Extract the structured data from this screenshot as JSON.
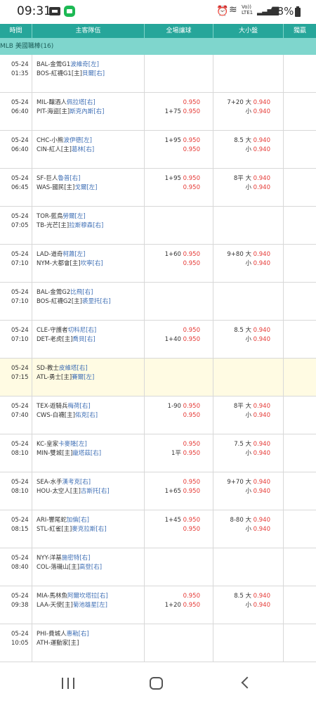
{
  "status_bar": {
    "time": "09:31",
    "icons": [
      "message-icon",
      "app-icon",
      "alarm-icon",
      "wifi-icon",
      "volte-icon",
      "signal-icon",
      "battery-icon"
    ],
    "volte_text": "Vo))\nLTE1",
    "battery": "88%"
  },
  "header": {
    "time": "時間",
    "teams": "主客隊伍",
    "handicap": "全場讓球",
    "over_under": "大小盤",
    "win": "獨贏"
  },
  "league": "MLB 美國職棒(16)",
  "colors": {
    "header_bg": "#26a69a",
    "league_bg": "#7fd6cd",
    "odds": "#e53935",
    "pitcher": "#3f6fb5",
    "highlight_row": "#fffbe3"
  },
  "matches": [
    {
      "date": "05-24",
      "time": "01:35",
      "away": "BAL-金鶯G1",
      "away_p": "波維奇[左]",
      "home": "BOS-紅襪G1[主]",
      "home_p": "貝爾[右]",
      "hdp1": "",
      "hdp1_odds": "",
      "hdp2": "",
      "hdp2_odds": "",
      "ou1": "",
      "ou1_odds": "",
      "ou2": "",
      "ou2_odds": ""
    },
    {
      "date": "05-24",
      "time": "06:40",
      "away": "MIL-釀酒人",
      "away_p": "佩拉塔[右]",
      "home": "PIT-海盜[主]",
      "home_p": "斯克內斯[右]",
      "hdp1": "",
      "hdp1_odds": "0.950",
      "hdp2": "1+75",
      "hdp2_odds": "0.950",
      "ou1": "7+20 大",
      "ou1_odds": "0.940",
      "ou2": "小",
      "ou2_odds": "0.940"
    },
    {
      "date": "05-24",
      "time": "06:40",
      "away": "CHC-小熊",
      "away_p": "波伊德[左]",
      "home": "CIN-紅人[主]",
      "home_p": "葛林[右]",
      "hdp1": "1+95",
      "hdp1_odds": "0.950",
      "hdp2": "",
      "hdp2_odds": "0.950",
      "ou1": "8.5 大",
      "ou1_odds": "0.940",
      "ou2": "小",
      "ou2_odds": "0.940"
    },
    {
      "date": "05-24",
      "time": "06:45",
      "away": "SF-巨人",
      "away_p": "魯普[右]",
      "home": "WAS-國民[主]",
      "home_p": "戈爾[左]",
      "hdp1": "1+95",
      "hdp1_odds": "0.950",
      "hdp2": "",
      "hdp2_odds": "0.950",
      "ou1": "8平 大",
      "ou1_odds": "0.940",
      "ou2": "小",
      "ou2_odds": "0.940"
    },
    {
      "date": "05-24",
      "time": "07:05",
      "away": "TOR-藍鳥",
      "away_p": "勞爾[左]",
      "home": "TB-光芒[主]",
      "home_p": "拉斯穆森[右]",
      "hdp1": "",
      "hdp1_odds": "",
      "hdp2": "",
      "hdp2_odds": "",
      "ou1": "",
      "ou1_odds": "",
      "ou2": "",
      "ou2_odds": ""
    },
    {
      "date": "05-24",
      "time": "07:10",
      "away": "LAD-道奇",
      "away_p": "柯蕭[左]",
      "home": "NYM-大都會[主]",
      "home_p": "坎寧[右]",
      "hdp1": "1+60",
      "hdp1_odds": "0.950",
      "hdp2": "",
      "hdp2_odds": "0.950",
      "ou1": "9+80 大",
      "ou1_odds": "0.940",
      "ou2": "小",
      "ou2_odds": "0.940"
    },
    {
      "date": "05-24",
      "time": "07:10",
      "away": "BAL-金鶯G2",
      "away_p": "比飛[右]",
      "home": "BOS-紅襪G2[主]",
      "home_p": "裘里托[右]",
      "hdp1": "",
      "hdp1_odds": "",
      "hdp2": "",
      "hdp2_odds": "",
      "ou1": "",
      "ou1_odds": "",
      "ou2": "",
      "ou2_odds": ""
    },
    {
      "date": "05-24",
      "time": "07:10",
      "away": "CLE-守護者",
      "away_p": "切科尼[右]",
      "home": "DET-老虎[主]",
      "home_p": "喬貝[右]",
      "hdp1": "",
      "hdp1_odds": "0.950",
      "hdp2": "1+40",
      "hdp2_odds": "0.950",
      "ou1": "8.5 大",
      "ou1_odds": "0.940",
      "ou2": "小",
      "ou2_odds": "0.940"
    },
    {
      "date": "05-24",
      "time": "07:15",
      "away": "SD-教士",
      "away_p": "皮維塔[右]",
      "home": "ATL-勇士[主]",
      "home_p": "賽爾[左]",
      "hdp1": "",
      "hdp1_odds": "",
      "hdp2": "",
      "hdp2_odds": "",
      "ou1": "",
      "ou1_odds": "",
      "ou2": "",
      "ou2_odds": "",
      "highlight": true
    },
    {
      "date": "05-24",
      "time": "07:40",
      "away": "TEX-遊騎兵",
      "away_p": "梅荷[右]",
      "home": "CWS-白襪[主]",
      "home_p": "佑克[右]",
      "hdp1": "1-90",
      "hdp1_odds": "0.950",
      "hdp2": "",
      "hdp2_odds": "0.950",
      "ou1": "8平 大",
      "ou1_odds": "0.940",
      "ou2": "小",
      "ou2_odds": "0.940"
    },
    {
      "date": "05-24",
      "time": "08:10",
      "away": "KC-皇家",
      "away_p": "卡麥隆[左]",
      "home": "MIN-雙城[主]",
      "home_p": "龐塔茲[右]",
      "hdp1": "",
      "hdp1_odds": "0.950",
      "hdp2": "1平",
      "hdp2_odds": "0.950",
      "ou1": "7.5 大",
      "ou1_odds": "0.940",
      "ou2": "小",
      "ou2_odds": "0.940"
    },
    {
      "date": "05-24",
      "time": "08:10",
      "away": "SEA-水手",
      "away_p": "漢考克[右]",
      "home": "HOU-太空人[主]",
      "home_p": "古斯托[右]",
      "hdp1": "",
      "hdp1_odds": "0.950",
      "hdp2": "1+65",
      "hdp2_odds": "0.950",
      "ou1": "9+70 大",
      "ou1_odds": "0.940",
      "ou2": "小",
      "ou2_odds": "0.940"
    },
    {
      "date": "05-24",
      "time": "08:15",
      "away": "ARI-響尾蛇",
      "away_p": "加倫[右]",
      "home": "STL-紅雀[主]",
      "home_p": "麥克拉斯[右]",
      "hdp1": "1+45",
      "hdp1_odds": "0.950",
      "hdp2": "",
      "hdp2_odds": "0.950",
      "ou1": "8-80 大",
      "ou1_odds": "0.940",
      "ou2": "小",
      "ou2_odds": "0.940"
    },
    {
      "date": "05-24",
      "time": "08:40",
      "away": "NYY-洋基",
      "away_p": "施密特[右]",
      "home": "COL-落磯山[主]",
      "home_p": "高登[右]",
      "hdp1": "",
      "hdp1_odds": "",
      "hdp2": "",
      "hdp2_odds": "",
      "ou1": "",
      "ou1_odds": "",
      "ou2": "",
      "ou2_odds": ""
    },
    {
      "date": "05-24",
      "time": "09:38",
      "away": "MIA-馬林魚",
      "away_p": "阿爾坎塔拉[右]",
      "home": "LAA-天使[主]",
      "home_p": "菊池雄星[左]",
      "hdp1": "",
      "hdp1_odds": "0.950",
      "hdp2": "1+20",
      "hdp2_odds": "0.950",
      "ou1": "8.5 大",
      "ou1_odds": "0.940",
      "ou2": "小",
      "ou2_odds": "0.940"
    },
    {
      "date": "05-24",
      "time": "10:05",
      "away": "PHI-費城人",
      "away_p": "惠勒[右]",
      "home": "ATH-運動家[主]",
      "home_p": "",
      "hdp1": "",
      "hdp1_odds": "",
      "hdp2": "",
      "hdp2_odds": "",
      "ou1": "",
      "ou1_odds": "",
      "ou2": "",
      "ou2_odds": ""
    }
  ],
  "nav": {
    "buttons": [
      "recent-apps-icon",
      "home-icon",
      "back-icon"
    ]
  }
}
